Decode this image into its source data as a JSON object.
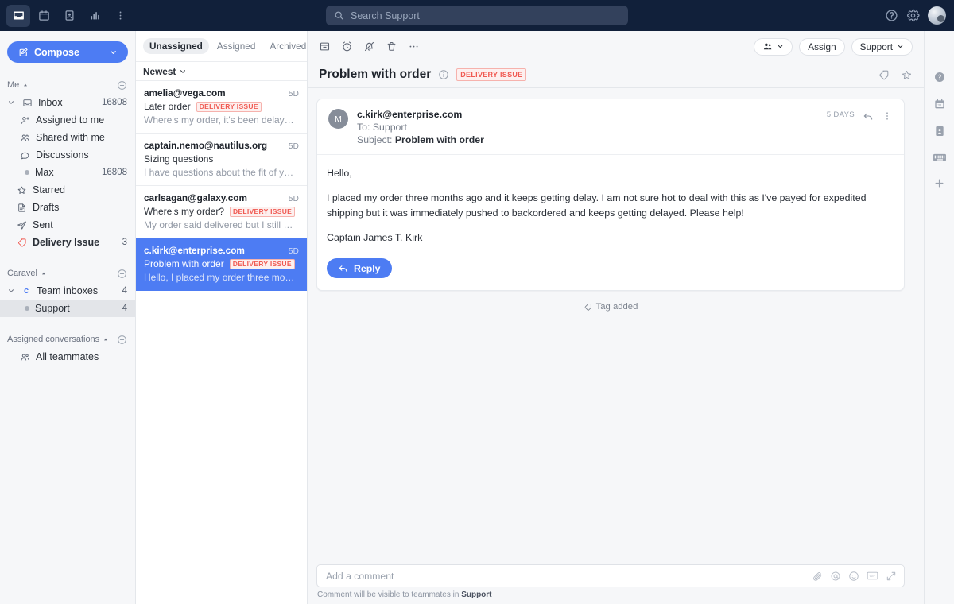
{
  "topbar": {
    "nav_icons": [
      {
        "name": "inbox-icon",
        "label": "Inbox",
        "active": true
      },
      {
        "name": "calendar-icon",
        "label": "Calendar",
        "active": false
      },
      {
        "name": "contacts-icon",
        "label": "Contacts",
        "active": false
      },
      {
        "name": "reports-icon",
        "label": "Reports",
        "active": false
      },
      {
        "name": "more-vertical-icon",
        "label": "More",
        "active": false
      }
    ],
    "search": {
      "placeholder": "Search Support",
      "value": ""
    },
    "help_label": "Help",
    "settings_label": "Settings",
    "avatar_label": "Account"
  },
  "sidebar": {
    "compose_label": "Compose",
    "sections": [
      {
        "title": "Me",
        "items": [
          {
            "label": "Inbox",
            "count": "16808",
            "icon": "inbox-icon",
            "indent": 0,
            "expandable": true,
            "bold": false
          },
          {
            "label": "Assigned to me",
            "count": "",
            "icon": "assigned-user-icon",
            "indent": 1,
            "bold": false
          },
          {
            "label": "Shared with me",
            "count": "",
            "icon": "users-icon",
            "indent": 1,
            "bold": false
          },
          {
            "label": "Discussions",
            "count": "",
            "icon": "chat-bubble-icon",
            "indent": 1,
            "bold": false
          },
          {
            "label": "Max",
            "count": "16808",
            "icon": "dot-icon",
            "indent": 1,
            "bold": false
          },
          {
            "label": "Starred",
            "count": "",
            "icon": "star-icon",
            "indent": 0,
            "bold": false
          },
          {
            "label": "Drafts",
            "count": "",
            "icon": "draft-icon",
            "indent": 0,
            "bold": false
          },
          {
            "label": "Sent",
            "count": "",
            "icon": "send-icon",
            "indent": 0,
            "bold": false
          },
          {
            "label": "Delivery Issue",
            "count": "3",
            "icon": "tag-icon",
            "indent": 0,
            "bold": true
          }
        ]
      },
      {
        "title": "Caravel",
        "items": [
          {
            "label": "Team inboxes",
            "count": "4",
            "icon": "team-letter-icon",
            "indent": 0,
            "expandable": true,
            "bold": false
          },
          {
            "label": "Support",
            "count": "4",
            "icon": "dot-icon",
            "indent": 1,
            "selected": true,
            "bold": false
          }
        ]
      },
      {
        "title": "Assigned conversations",
        "items": [
          {
            "label": "All teammates",
            "count": "",
            "icon": "users-icon",
            "indent": 1,
            "bold": false
          }
        ]
      }
    ]
  },
  "list": {
    "tabs": [
      {
        "label": "Unassigned",
        "active": true
      },
      {
        "label": "Assigned",
        "active": false
      },
      {
        "label": "Archived",
        "active": false
      }
    ],
    "sort_label": "Newest",
    "conversations": [
      {
        "from": "amelia@vega.com",
        "time": "5D",
        "subject": "Later order",
        "tag": "DELIVERY ISSUE",
        "preview": "Where's my order, it's been delay…",
        "selected": false
      },
      {
        "from": "captain.nemo@nautilus.org",
        "time": "5D",
        "subject": "Sizing questions",
        "tag": "",
        "preview": "I have questions about the fit of y…",
        "selected": false
      },
      {
        "from": "carlsagan@galaxy.com",
        "time": "5D",
        "subject": "Where's my order?",
        "tag": "DELIVERY ISSUE",
        "preview": "My order said delivered but I still …",
        "selected": false
      },
      {
        "from": "c.kirk@enterprise.com",
        "time": "5D",
        "subject": "Problem with order",
        "tag": "DELIVERY ISSUE",
        "preview": "Hello, I placed my order three mo…",
        "selected": true
      }
    ]
  },
  "main": {
    "toolbar_icons": [
      {
        "name": "archive-icon",
        "label": "Archive"
      },
      {
        "name": "snooze-clock-icon",
        "label": "Snooze"
      },
      {
        "name": "mute-bell-icon",
        "label": "Mute"
      },
      {
        "name": "trash-icon",
        "label": "Delete"
      },
      {
        "name": "more-horizontal-icon",
        "label": "More"
      }
    ],
    "assignee_pill_label": "",
    "assign_label": "Assign",
    "inbox_pill_label": "Support",
    "title": "Problem with order",
    "title_tag": "DELIVERY ISSUE",
    "message": {
      "avatar_initial": "M",
      "from": "c.kirk@enterprise.com",
      "to_label": "To:",
      "to_value": "Support",
      "subject_label": "Subject:",
      "subject_value": "Problem with order",
      "age": "5 DAYS",
      "paragraphs": [
        "Hello,",
        "I placed my order three months ago and it keeps getting delay. I am not sure hot to deal with this as I've payed for expedited shipping but it was immediately pushed to backordered and keeps getting delayed. Please help!",
        "Captain James T. Kirk"
      ],
      "reply_label": "Reply"
    },
    "event_label": "Tag added"
  },
  "comment": {
    "placeholder": "Add a comment",
    "value": "",
    "note_prefix": "Comment will be visible to teammates in",
    "note_target": "Support",
    "icons": [
      {
        "name": "attachment-icon",
        "label": "Attach file"
      },
      {
        "name": "mention-icon",
        "label": "Mention"
      },
      {
        "name": "emoji-icon",
        "label": "Emoji"
      },
      {
        "name": "gif-icon",
        "label": "GIF"
      },
      {
        "name": "expand-icon",
        "label": "Expand"
      }
    ]
  },
  "rightrail": {
    "icons": [
      {
        "name": "help-icon",
        "label": "Help"
      },
      {
        "name": "calendar-icon",
        "label": "Calendar"
      },
      {
        "name": "contact-card-icon",
        "label": "Contact"
      },
      {
        "name": "keyboard-icon",
        "label": "Keyboard shortcuts"
      },
      {
        "name": "add-app-icon",
        "label": "Add"
      }
    ]
  },
  "colors": {
    "topbar_bg": "#11203a",
    "accent_blue": "#4d7cf3",
    "tag_red": "#f05a52",
    "sidebar_bg": "#f6f7f9"
  }
}
